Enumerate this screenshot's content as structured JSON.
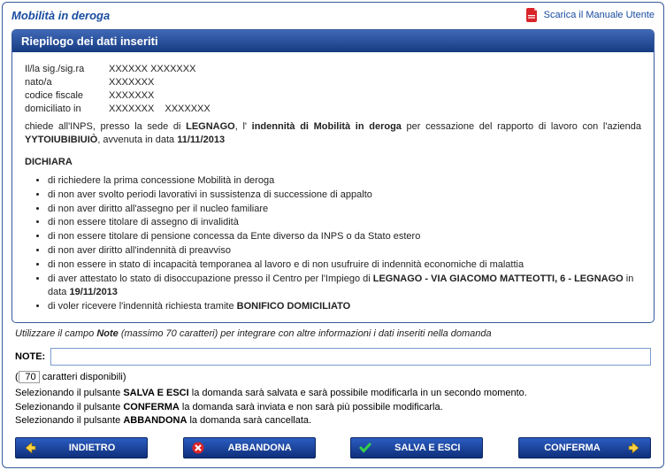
{
  "page_title": "Mobilità in deroga",
  "download_label": "Scarica il Manuale Utente",
  "panel_header": "Riepilogo dei dati inseriti",
  "person": {
    "label_sig": "Il/la sig./sig.ra",
    "name": "XXXXXX XXXXXXX",
    "label_nato": "nato/a",
    "birth": "XXXXXXX",
    "label_cf": "codice fiscale",
    "cf": "XXXXXXX",
    "label_dom": "domiciliato in",
    "dom1": "XXXXXXX",
    "dom2": "XXXXXXX"
  },
  "request": {
    "t1": "chiede all'INPS, presso la sede di ",
    "sede": "LEGNAGO",
    "t2": ", l' ",
    "indennita": "indennità di Mobilità in deroga",
    "t3": " per cessazione del rapporto di lavoro con l'azienda ",
    "azienda": "YYTOIUBIBIUIÒ",
    "t4": ", avvenuta in data ",
    "data": "11/11/2013"
  },
  "dichiara_label": "DICHIARA",
  "dich": [
    "di richiedere la prima concessione Mobilità in deroga",
    "di non aver svolto periodi lavorativi in sussistenza di successione di appalto",
    "di non aver diritto all'assegno per il nucleo familiare",
    "di non essere titolare di assegno di invalidità",
    "di non essere titolare di pensione concessa da Ente diverso da INPS o da Stato estero",
    "di non aver diritto all'indennità di preavviso",
    "di non essere in stato di incapacità temporanea al lavoro e di non usufruire di indennità economiche di malattia"
  ],
  "dich8": {
    "t1": "di aver attestato lo stato di disoccupazione presso il Centro per l'Impiego di ",
    "cpi": "LEGNAGO - VIA GIACOMO MATTEOTTI, 6 - LEGNAGO",
    "t2": " in data ",
    "data": "19/11/2013"
  },
  "dich9": {
    "t1": "di voler ricevere l'indennità richiesta tramite ",
    "mod": "BONIFICO DOMICILIATO"
  },
  "note_hint_pre": "Utilizzare il campo ",
  "note_hint_b": "Note",
  "note_hint_post": " (massimo 70 caratteri) per integrare con altre informazioni i dati inseriti nella domanda",
  "note_label": "NOTE:",
  "note_value": "",
  "char_count": "70",
  "char_suffix": " caratteri disponibili)",
  "instr": {
    "l1a": "Selezionando il pulsante ",
    "l1b": "SALVA E ESCI",
    "l1c": " la domanda sarà salvata e sarà possibile modificarla in un secondo momento.",
    "l2a": "Selezionando il pulsante ",
    "l2b": "CONFERMA",
    "l2c": " la domanda sarà inviata e non sarà più possibile modificarla.",
    "l3a": "Selezionando il pulsante ",
    "l3b": "ABBANDONA",
    "l3c": " la domanda sarà cancellata."
  },
  "buttons": {
    "back": "INDIETRO",
    "abandon": "ABBANDONA",
    "save": "SALVA E ESCI",
    "confirm": "CONFERMA"
  }
}
